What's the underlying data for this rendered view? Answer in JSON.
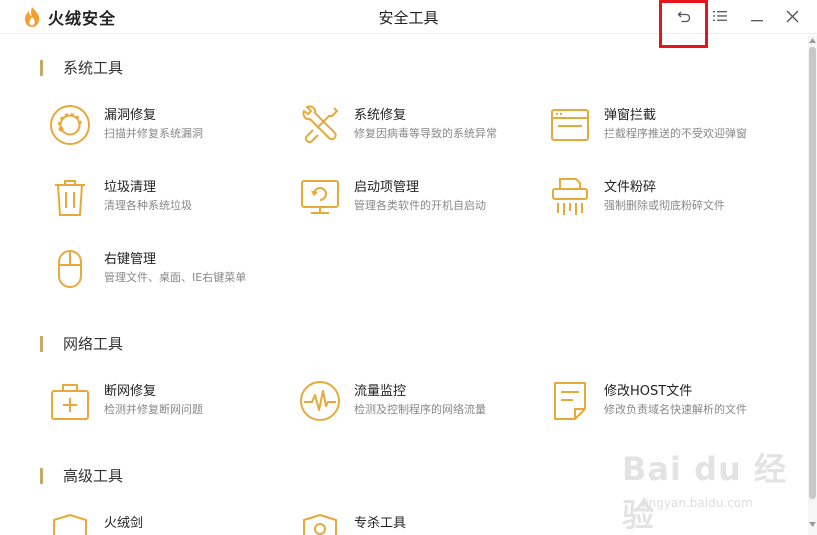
{
  "app": {
    "brand": "火绒安全",
    "window_title": "安全工具"
  },
  "colors": {
    "accent": "#e8a93b",
    "section_bar": "#c9a86b",
    "highlight": "#e8141c"
  },
  "titlebar": {
    "back_icon": "undo-arrow-icon",
    "menu_icon": "list-menu-icon",
    "minimize_icon": "minimize-icon",
    "close_icon": "close-icon"
  },
  "sections": [
    {
      "title": "系统工具",
      "tools": [
        {
          "name": "漏洞修复",
          "desc": "扫描并修复系统漏洞",
          "icon": "vulnerability-repair-icon"
        },
        {
          "name": "系统修复",
          "desc": "修复因病毒等导致的系统异常",
          "icon": "wrench-screwdriver-icon"
        },
        {
          "name": "弹窗拦截",
          "desc": "拦截程序推送的不受欢迎弹窗",
          "icon": "popup-window-icon"
        },
        {
          "name": "垃圾清理",
          "desc": "清理各种系统垃圾",
          "icon": "trash-bin-icon"
        },
        {
          "name": "启动项管理",
          "desc": "管理各类软件的开机自启动",
          "icon": "monitor-startup-icon"
        },
        {
          "name": "文件粉碎",
          "desc": "强制删除或彻底粉碎文件",
          "icon": "shredder-icon"
        },
        {
          "name": "右键管理",
          "desc": "管理文件、桌面、IE右键菜单",
          "icon": "mouse-icon"
        }
      ]
    },
    {
      "title": "网络工具",
      "tools": [
        {
          "name": "断网修复",
          "desc": "检测并修复断网问题",
          "icon": "first-aid-kit-icon"
        },
        {
          "name": "流量监控",
          "desc": "检测及控制程序的网络流量",
          "icon": "traffic-pulse-icon"
        },
        {
          "name": "修改HOST文件",
          "desc": "修改负责域名快速解析的文件",
          "icon": "host-file-icon"
        }
      ]
    },
    {
      "title": "高级工具",
      "tools": [
        {
          "name": "火绒剑",
          "desc": "",
          "icon": "shield-icon"
        },
        {
          "name": "专杀工具",
          "desc": "",
          "icon": "shield-tool-icon"
        }
      ]
    }
  ],
  "watermark": {
    "main": "Bai du 经验",
    "sub": "jingyan.baidu.com"
  }
}
